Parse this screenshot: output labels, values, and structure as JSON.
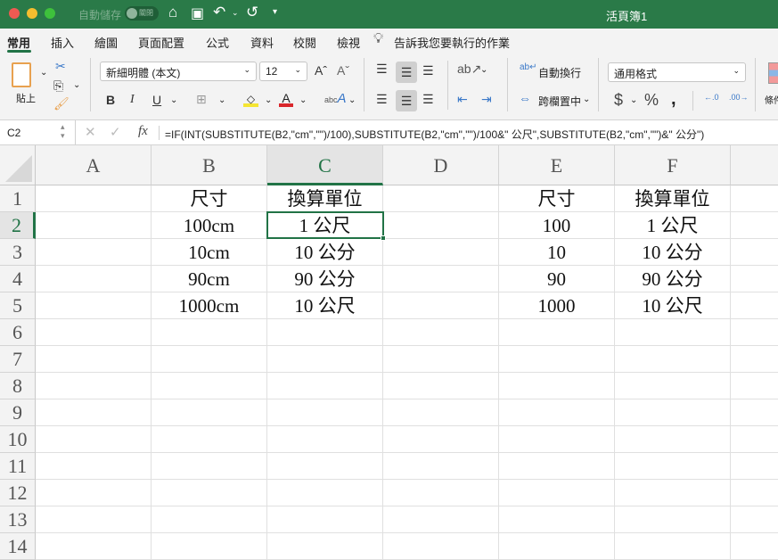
{
  "titlebar": {
    "autosave_label": "自動儲存",
    "autosave_state": "關閉",
    "title": "活頁簿1"
  },
  "tabs": [
    "常用",
    "插入",
    "繪圖",
    "頁面配置",
    "公式",
    "資料",
    "校閱",
    "檢視"
  ],
  "tell_me": "告訴我您要執行的作業",
  "ribbon": {
    "paste": "貼上",
    "font_name": "新細明體 (本文)",
    "font_size": "12",
    "wrap_text": "自動換行",
    "merge_center": "跨欄置中",
    "number_format": "通用格式",
    "cond_format": "條件式格式"
  },
  "formula_bar": {
    "name_box": "C2",
    "fx": "fx",
    "formula": "=IF(INT(SUBSTITUTE(B2,\"cm\",\"\")/100),SUBSTITUTE(B2,\"cm\",\"\")/100&\" 公尺\",SUBSTITUTE(B2,\"cm\",\"\")&\" 公分\")"
  },
  "columns": [
    "A",
    "B",
    "C",
    "D",
    "E",
    "F"
  ],
  "rows": [
    "1",
    "2",
    "3",
    "4",
    "5",
    "6",
    "7",
    "8",
    "9",
    "10",
    "11",
    "12",
    "13",
    "14"
  ],
  "selected_cell": "C2",
  "cells": [
    [
      "",
      "尺寸",
      "換算單位",
      "",
      "尺寸",
      "換算單位"
    ],
    [
      "",
      "100cm",
      "1 公尺",
      "",
      "100",
      "1 公尺"
    ],
    [
      "",
      "10cm",
      "10 公分",
      "",
      "10",
      "10 公分"
    ],
    [
      "",
      "90cm",
      "90 公分",
      "",
      "90",
      "90 公分"
    ],
    [
      "",
      "1000cm",
      "10 公尺",
      "",
      "1000",
      "10 公尺"
    ]
  ],
  "colors": {
    "accent": "#217346",
    "titlebar": "#2a7a48"
  }
}
